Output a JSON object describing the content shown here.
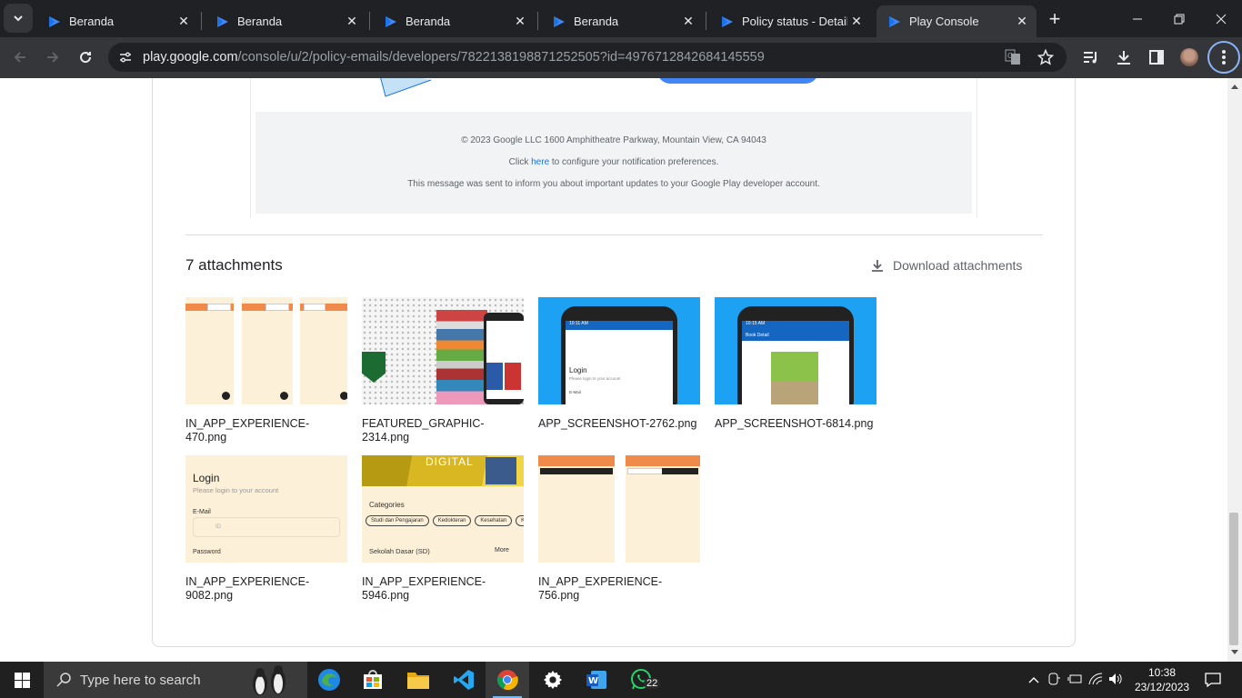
{
  "browser": {
    "tabs": [
      {
        "title": "Beranda",
        "active": false
      },
      {
        "title": "Beranda",
        "active": false
      },
      {
        "title": "Beranda",
        "active": false
      },
      {
        "title": "Beranda",
        "active": false
      },
      {
        "title": "Policy status - Details",
        "active": false
      },
      {
        "title": "Play Console",
        "active": true
      }
    ],
    "url_domain": "play.google.com",
    "url_path": "/console/u/2/policy-emails/developers/7822138198871252505?id=4976712842684145559"
  },
  "email": {
    "footer_copyright": "© 2023 Google LLC 1600 Amphitheatre Parkway, Mountain View, CA 94043",
    "footer_click_pre": "Click ",
    "footer_link": "here",
    "footer_click_post": " to configure your notification preferences.",
    "footer_message": "This message was sent to inform you about important updates to your Google Play developer account."
  },
  "attachments": {
    "title": "7 attachments",
    "download_label": "Download attachments",
    "items": [
      {
        "name": "IN_APP_EXPERIENCE-470.png"
      },
      {
        "name": "FEATURED_GRAPHIC-2314.png"
      },
      {
        "name": "APP_SCREENSHOT-2762.png"
      },
      {
        "name": "APP_SCREENSHOT-6814.png"
      },
      {
        "name": "IN_APP_EXPERIENCE-9082.png"
      },
      {
        "name": "IN_APP_EXPERIENCE-5946.png"
      },
      {
        "name": "IN_APP_EXPERIENCE-756.png"
      }
    ],
    "thumb_text": {
      "login_title": "Login",
      "login_sub": "Please login to your account",
      "email_label": "E-Mail",
      "id_placeholder": "ID",
      "password_label": "Password",
      "digital": "DIGITAL",
      "categories": "Categories",
      "chips": [
        "Studi dan Pengajaran",
        "Kedokteran",
        "Kesehatan",
        "Ko"
      ],
      "sd": "Sekolah Dasar (SD)",
      "more": "More",
      "book_detail": "Book Detail",
      "time1": "10:11 AM",
      "time2": "10:15 AM"
    }
  },
  "taskbar": {
    "search_placeholder": "Type here to search",
    "whatsapp_badge": "22",
    "time": "10:38",
    "date": "23/12/2023"
  },
  "colors": {
    "accent": "#1a73e8",
    "app_orange": "#f08a4b",
    "app_bg": "#fdf0d8",
    "blue_bg": "#1da1f2"
  }
}
